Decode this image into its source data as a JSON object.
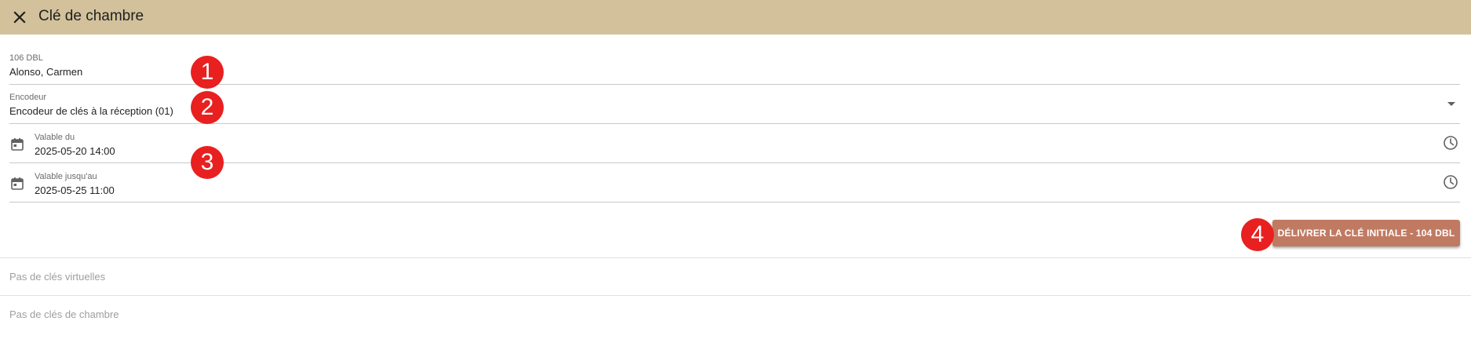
{
  "header": {
    "title": "Clé de chambre",
    "close_icon": "close-icon",
    "background": "#d2c19b"
  },
  "guest": {
    "label": "106 DBL",
    "value": "Alonso, Carmen"
  },
  "encoder": {
    "label": "Encodeur",
    "value": "Encodeur de clés à la réception (01)",
    "icon": "dropdown-arrow-icon"
  },
  "valid_from": {
    "label": "Valable du",
    "value": "2025-05-20 14:00",
    "icon_left": "calendar-icon",
    "icon_right": "clock-icon"
  },
  "valid_until": {
    "label": "Valable jusqu'au",
    "value": "2025-05-25 11:00",
    "icon_left": "calendar-icon",
    "icon_right": "clock-icon"
  },
  "action": {
    "label": "DÉLIVRER LA CLÉ INITIALE - 104 DBL",
    "color": "#c17a62"
  },
  "lists": {
    "virtual_keys_empty": "Pas de clés virtuelles",
    "room_keys_empty": "Pas de clés de chambre"
  },
  "annotations": {
    "one": "1",
    "two": "2",
    "three": "3",
    "four": "4",
    "color": "#e8201f"
  }
}
